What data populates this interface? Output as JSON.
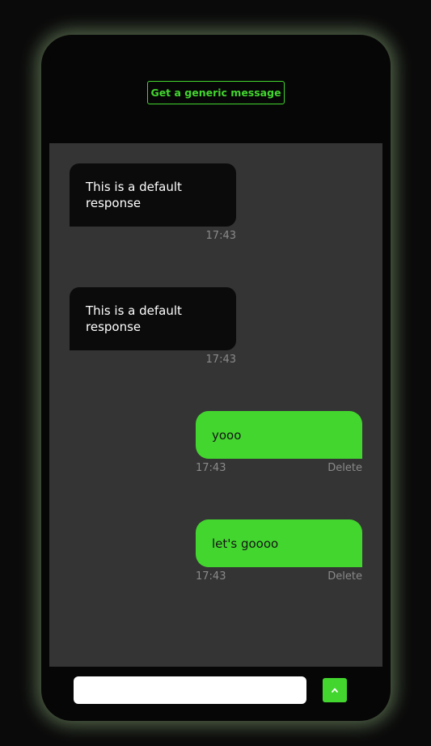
{
  "header": {
    "generic_button_label": "Get a generic message"
  },
  "messages": [
    {
      "sender": "bot",
      "text": "This is a default response",
      "time": "17:43"
    },
    {
      "sender": "bot",
      "text": "This is a default response",
      "time": "17:43"
    },
    {
      "sender": "user",
      "text": "yooo",
      "time": "17:43",
      "delete_label": "Delete"
    },
    {
      "sender": "user",
      "text": "let's goooo",
      "time": "17:43",
      "delete_label": "Delete"
    }
  ],
  "footer": {
    "input_value": "",
    "send_icon": "chevron-up-icon"
  },
  "colors": {
    "accent": "#43d62f",
    "chat_background": "#343434",
    "bot_bubble": "#0b0b0b",
    "frame": "#060606"
  }
}
